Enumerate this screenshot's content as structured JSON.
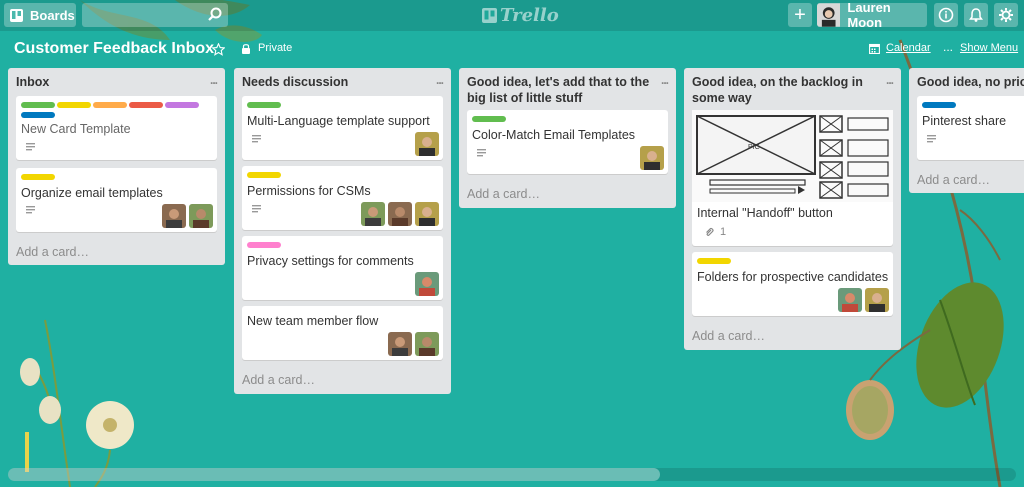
{
  "header": {
    "boards_label": "Boards",
    "search_placeholder": "",
    "logo_text": "Trello",
    "add_icon": "+",
    "user_name": "Lauren Moon"
  },
  "board": {
    "title": "Customer Feedback Inbox",
    "visibility": "Private",
    "calendar_label": "Calendar",
    "dots": "...",
    "show_menu_label": "Show Menu"
  },
  "colors": {
    "background": "#1fb0a2",
    "list_bg": "#e2e4e6",
    "label_green": "#61bd4f",
    "label_yellow": "#f2d600",
    "label_orange": "#ffab4a",
    "label_red": "#eb5a46",
    "label_purple": "#c377e0",
    "label_blue": "#0079bf",
    "label_pink": "#ff80ce"
  },
  "lists": [
    {
      "title": "Inbox",
      "menu": "...",
      "add_card": "Add a card…",
      "cards": [
        {
          "title": "New Card Template",
          "labels": [
            "green",
            "yellow",
            "orange",
            "red",
            "purple",
            "blue"
          ],
          "has_description": true,
          "members": 0
        },
        {
          "title": "Organize email templates",
          "labels": [
            "yellow"
          ],
          "has_description": true,
          "members": 2
        }
      ]
    },
    {
      "title": "Needs discussion",
      "menu": "...",
      "add_card": "Add a card…",
      "cards": [
        {
          "title": "Multi-Language template support",
          "labels": [
            "green"
          ],
          "has_description": true,
          "members": 1
        },
        {
          "title": "Permissions for CSMs",
          "labels": [
            "yellow"
          ],
          "has_description": true,
          "members": 3
        },
        {
          "title": "Privacy settings for comments",
          "labels": [
            "pink"
          ],
          "has_description": false,
          "members": 1
        },
        {
          "title": "New team member flow",
          "labels": [],
          "has_description": false,
          "members": 2
        }
      ]
    },
    {
      "title": "Good idea, let's add that to the big list of little stuff",
      "menu": "...",
      "add_card": "Add a card…",
      "cards": [
        {
          "title": "Color-Match Email Templates",
          "labels": [
            "green"
          ],
          "has_description": true,
          "members": 1
        }
      ]
    },
    {
      "title": "Good idea, on the backlog in some way",
      "menu": "...",
      "add_card": "Add a card…",
      "cards": [
        {
          "title": "Internal \"Handoff\" button",
          "labels": [],
          "has_cover_image": true,
          "cover_text": "PIC",
          "attachments": "1",
          "members": 0
        },
        {
          "title": "Folders for prospective candidates",
          "labels": [
            "yellow"
          ],
          "has_description": false,
          "members": 2
        }
      ]
    },
    {
      "title": "Good idea, no priori",
      "menu": "",
      "add_card": "Add a card…",
      "cards": [
        {
          "title": "Pinterest share",
          "labels": [
            "blue"
          ],
          "has_description": true,
          "members": 0
        }
      ]
    }
  ]
}
